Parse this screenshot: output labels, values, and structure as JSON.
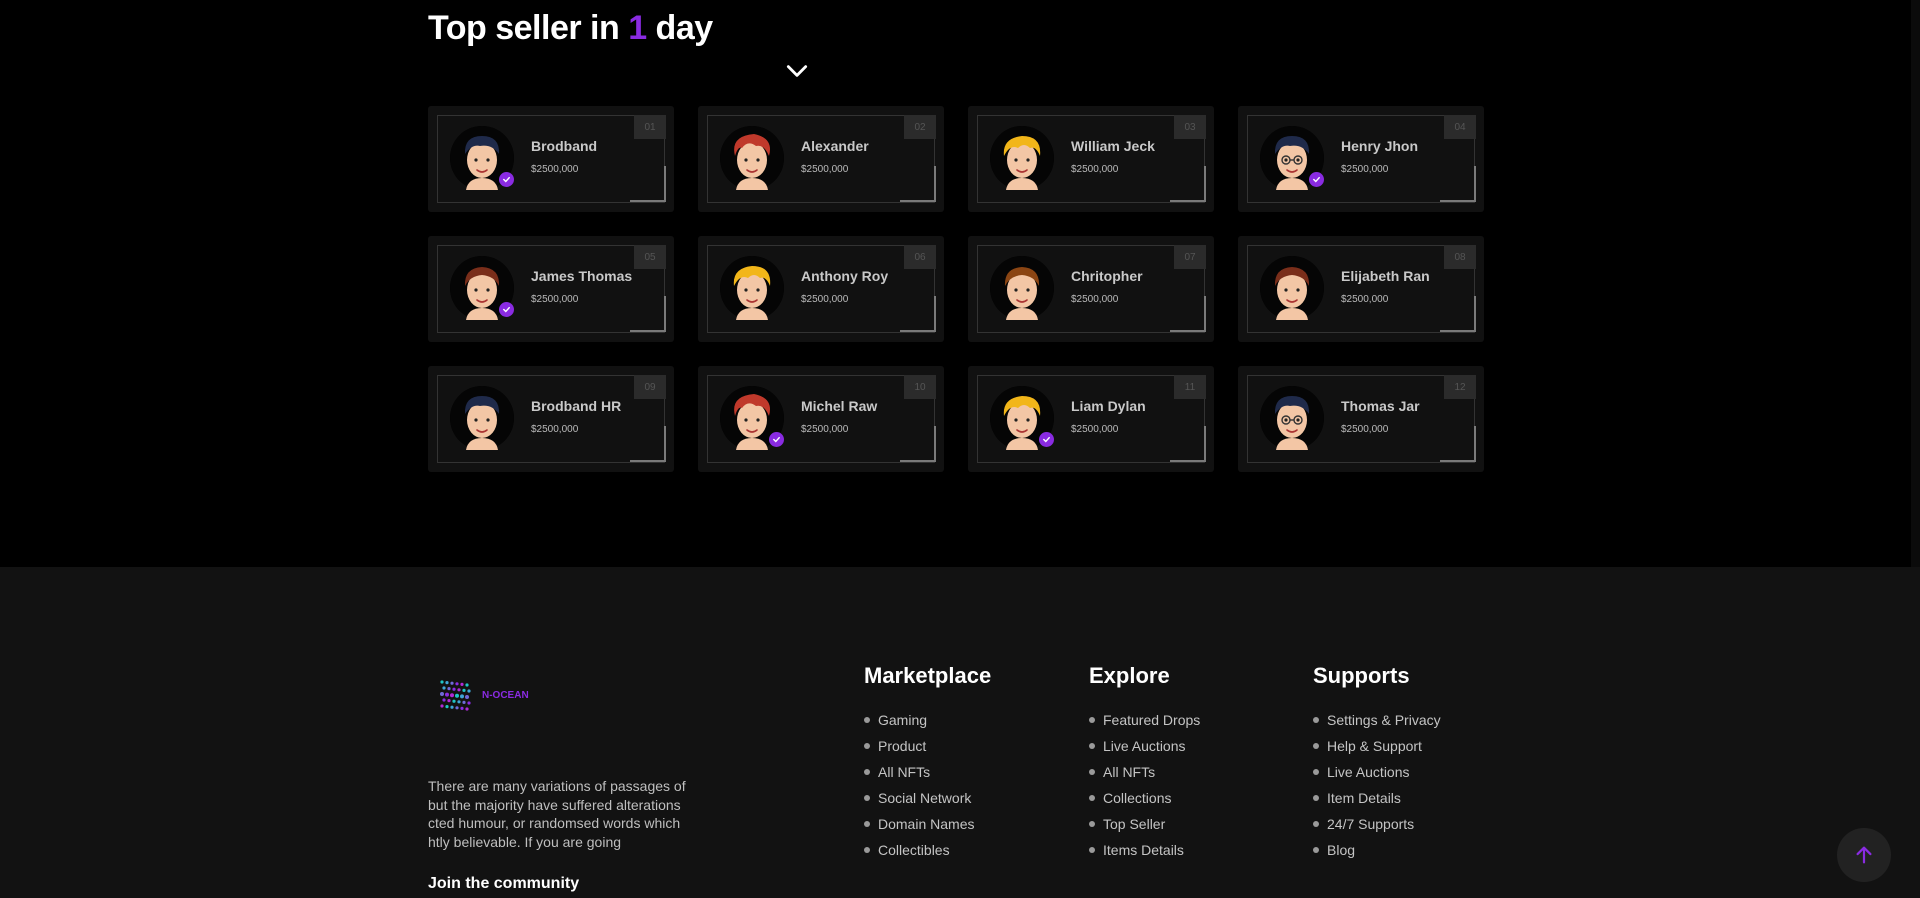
{
  "section": {
    "title_prefix": "Top seller in ",
    "title_highlight": "1",
    "title_suffix": " day",
    "dropdown_icon": "chevron-down-icon"
  },
  "sellers": [
    {
      "name": "Brodband",
      "price": "$2500,000",
      "rank": "01",
      "verified": true,
      "hair": "#1f2a4a",
      "style": "dark"
    },
    {
      "name": "Alexander",
      "price": "$2500,000",
      "rank": "02",
      "verified": false,
      "hair": "#c0392b",
      "style": "red"
    },
    {
      "name": "William Jeck",
      "price": "$2500,000",
      "rank": "03",
      "verified": false,
      "hair": "#f2b619",
      "style": "blond"
    },
    {
      "name": "Henry Jhon",
      "price": "$2500,000",
      "rank": "04",
      "verified": true,
      "hair": "#1f2a4a",
      "style": "glasses"
    },
    {
      "name": "James Thomas",
      "price": "$2500,000",
      "rank": "05",
      "verified": true,
      "hair": "#7a2e1a",
      "style": "brown"
    },
    {
      "name": "Anthony Roy",
      "price": "$2500,000",
      "rank": "06",
      "verified": false,
      "hair": "#f2b619",
      "style": "blond"
    },
    {
      "name": "Chritopher",
      "price": "$2500,000",
      "rank": "07",
      "verified": false,
      "hair": "#8b4513",
      "style": "brown"
    },
    {
      "name": "Elijabeth Ran",
      "price": "$2500,000",
      "rank": "08",
      "verified": false,
      "hair": "#7a2e1a",
      "style": "brown"
    },
    {
      "name": "Brodband HR",
      "price": "$2500,000",
      "rank": "09",
      "verified": false,
      "hair": "#1f2a4a",
      "style": "dark"
    },
    {
      "name": "Michel Raw",
      "price": "$2500,000",
      "rank": "10",
      "verified": true,
      "hair": "#c0392b",
      "style": "red"
    },
    {
      "name": "Liam Dylan",
      "price": "$2500,000",
      "rank": "11",
      "verified": true,
      "hair": "#f2b619",
      "style": "blond"
    },
    {
      "name": "Thomas Jar",
      "price": "$2500,000",
      "rank": "12",
      "verified": false,
      "hair": "#1f2a4a",
      "style": "glasses"
    }
  ],
  "footer": {
    "logo_text": "N-OCEAN",
    "about": "There are many variations of passages of but the majority have suffered alterations cted humour, or randomsed words which htly believable. If you are going",
    "join_title": "Join the community",
    "columns": [
      {
        "title": "Marketplace",
        "links": [
          "Gaming",
          "Product",
          "All NFTs",
          "Social Network",
          "Domain Names",
          "Collectibles"
        ]
      },
      {
        "title": "Explore",
        "links": [
          "Featured Drops",
          "Live Auctions",
          "All NFTs",
          "Collections",
          "Top Seller",
          "Items Details"
        ]
      },
      {
        "title": "Supports",
        "links": [
          "Settings & Privacy",
          "Help & Support",
          "Live Auctions",
          "Item Details",
          "24/7 Supports",
          "Blog"
        ]
      }
    ]
  },
  "colors": {
    "accent": "#8a2be2",
    "card": "#111111",
    "footer_bg": "#121212"
  },
  "scroll_top_icon": "arrow-up-icon"
}
